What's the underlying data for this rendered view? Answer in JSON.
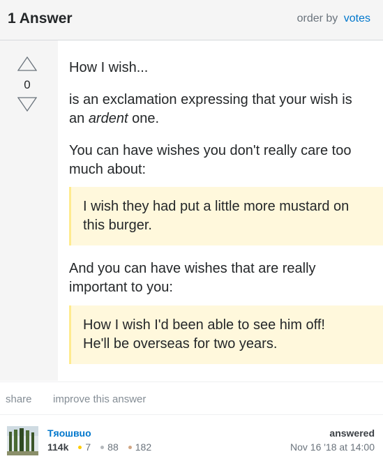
{
  "header": {
    "answer_count": "1 Answer",
    "order_by_label": "order by",
    "order_by_value": "votes"
  },
  "answer": {
    "vote_count": "0",
    "paragraphs": {
      "p1": "How I wish...",
      "p2_before": "is an exclamation expressing that your wish is an ",
      "p2_em": "ardent",
      "p2_after": " one.",
      "p3": "You can have wishes you don't really care too much about:",
      "p4": "And you can have wishes that are really important to you:"
    },
    "quotes": {
      "q1": "I wish they had put a little more mustard on this burger.",
      "q2_line1": "How I wish I'd been able to see him off!",
      "q2_line2": "He'll be overseas for two years."
    }
  },
  "actions": {
    "share": "share",
    "improve": "improve this answer"
  },
  "user": {
    "name": "Tяoшвuo",
    "reputation": "114k",
    "gold": "7",
    "silver": "88",
    "bronze": "182",
    "answered_label": "answered",
    "answered_date": "Nov 16 '18 at 14:00"
  },
  "colors": {
    "accent": "#0077cc",
    "gold_badge": "#ffcc01",
    "silver_badge": "#b4b8bc",
    "bronze_badge": "#d1a684",
    "quote_bg": "#fff8dc",
    "quote_border": "#ffeb8e"
  },
  "icons": {
    "vote_up": "triangle-up-outline-icon",
    "vote_down": "triangle-down-outline-icon"
  }
}
